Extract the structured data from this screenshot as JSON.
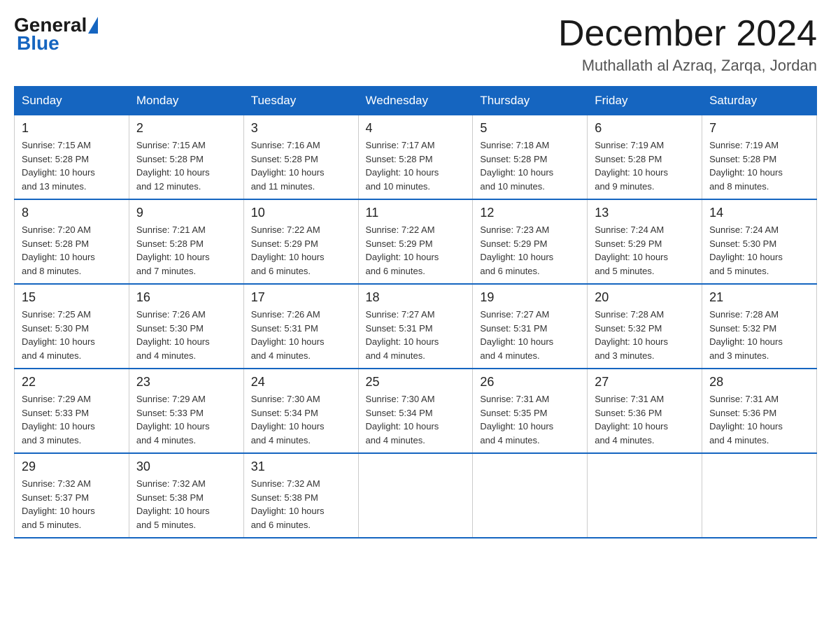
{
  "logo": {
    "general": "General",
    "blue": "Blue"
  },
  "title": "December 2024",
  "location": "Muthallath al Azraq, Zarqa, Jordan",
  "days_of_week": [
    "Sunday",
    "Monday",
    "Tuesday",
    "Wednesday",
    "Thursday",
    "Friday",
    "Saturday"
  ],
  "weeks": [
    [
      {
        "day": "1",
        "sunrise": "7:15 AM",
        "sunset": "5:28 PM",
        "daylight": "10 hours and 13 minutes."
      },
      {
        "day": "2",
        "sunrise": "7:15 AM",
        "sunset": "5:28 PM",
        "daylight": "10 hours and 12 minutes."
      },
      {
        "day": "3",
        "sunrise": "7:16 AM",
        "sunset": "5:28 PM",
        "daylight": "10 hours and 11 minutes."
      },
      {
        "day": "4",
        "sunrise": "7:17 AM",
        "sunset": "5:28 PM",
        "daylight": "10 hours and 10 minutes."
      },
      {
        "day": "5",
        "sunrise": "7:18 AM",
        "sunset": "5:28 PM",
        "daylight": "10 hours and 10 minutes."
      },
      {
        "day": "6",
        "sunrise": "7:19 AM",
        "sunset": "5:28 PM",
        "daylight": "10 hours and 9 minutes."
      },
      {
        "day": "7",
        "sunrise": "7:19 AM",
        "sunset": "5:28 PM",
        "daylight": "10 hours and 8 minutes."
      }
    ],
    [
      {
        "day": "8",
        "sunrise": "7:20 AM",
        "sunset": "5:28 PM",
        "daylight": "10 hours and 8 minutes."
      },
      {
        "day": "9",
        "sunrise": "7:21 AM",
        "sunset": "5:28 PM",
        "daylight": "10 hours and 7 minutes."
      },
      {
        "day": "10",
        "sunrise": "7:22 AM",
        "sunset": "5:29 PM",
        "daylight": "10 hours and 6 minutes."
      },
      {
        "day": "11",
        "sunrise": "7:22 AM",
        "sunset": "5:29 PM",
        "daylight": "10 hours and 6 minutes."
      },
      {
        "day": "12",
        "sunrise": "7:23 AM",
        "sunset": "5:29 PM",
        "daylight": "10 hours and 6 minutes."
      },
      {
        "day": "13",
        "sunrise": "7:24 AM",
        "sunset": "5:29 PM",
        "daylight": "10 hours and 5 minutes."
      },
      {
        "day": "14",
        "sunrise": "7:24 AM",
        "sunset": "5:30 PM",
        "daylight": "10 hours and 5 minutes."
      }
    ],
    [
      {
        "day": "15",
        "sunrise": "7:25 AM",
        "sunset": "5:30 PM",
        "daylight": "10 hours and 4 minutes."
      },
      {
        "day": "16",
        "sunrise": "7:26 AM",
        "sunset": "5:30 PM",
        "daylight": "10 hours and 4 minutes."
      },
      {
        "day": "17",
        "sunrise": "7:26 AM",
        "sunset": "5:31 PM",
        "daylight": "10 hours and 4 minutes."
      },
      {
        "day": "18",
        "sunrise": "7:27 AM",
        "sunset": "5:31 PM",
        "daylight": "10 hours and 4 minutes."
      },
      {
        "day": "19",
        "sunrise": "7:27 AM",
        "sunset": "5:31 PM",
        "daylight": "10 hours and 4 minutes."
      },
      {
        "day": "20",
        "sunrise": "7:28 AM",
        "sunset": "5:32 PM",
        "daylight": "10 hours and 3 minutes."
      },
      {
        "day": "21",
        "sunrise": "7:28 AM",
        "sunset": "5:32 PM",
        "daylight": "10 hours and 3 minutes."
      }
    ],
    [
      {
        "day": "22",
        "sunrise": "7:29 AM",
        "sunset": "5:33 PM",
        "daylight": "10 hours and 3 minutes."
      },
      {
        "day": "23",
        "sunrise": "7:29 AM",
        "sunset": "5:33 PM",
        "daylight": "10 hours and 4 minutes."
      },
      {
        "day": "24",
        "sunrise": "7:30 AM",
        "sunset": "5:34 PM",
        "daylight": "10 hours and 4 minutes."
      },
      {
        "day": "25",
        "sunrise": "7:30 AM",
        "sunset": "5:34 PM",
        "daylight": "10 hours and 4 minutes."
      },
      {
        "day": "26",
        "sunrise": "7:31 AM",
        "sunset": "5:35 PM",
        "daylight": "10 hours and 4 minutes."
      },
      {
        "day": "27",
        "sunrise": "7:31 AM",
        "sunset": "5:36 PM",
        "daylight": "10 hours and 4 minutes."
      },
      {
        "day": "28",
        "sunrise": "7:31 AM",
        "sunset": "5:36 PM",
        "daylight": "10 hours and 4 minutes."
      }
    ],
    [
      {
        "day": "29",
        "sunrise": "7:32 AM",
        "sunset": "5:37 PM",
        "daylight": "10 hours and 5 minutes."
      },
      {
        "day": "30",
        "sunrise": "7:32 AM",
        "sunset": "5:38 PM",
        "daylight": "10 hours and 5 minutes."
      },
      {
        "day": "31",
        "sunrise": "7:32 AM",
        "sunset": "5:38 PM",
        "daylight": "10 hours and 6 minutes."
      },
      null,
      null,
      null,
      null
    ]
  ],
  "labels": {
    "sunrise": "Sunrise:",
    "sunset": "Sunset:",
    "daylight": "Daylight:"
  }
}
